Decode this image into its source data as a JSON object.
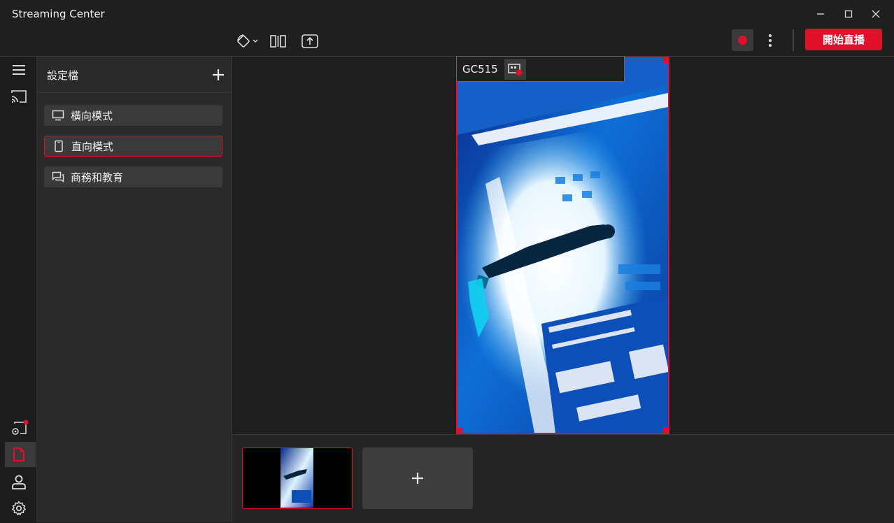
{
  "window": {
    "title": "Streaming Center"
  },
  "toolbar": {
    "go_live_label": "開始直播",
    "record_color": "#e0102a"
  },
  "sidebar": {
    "title": "設定檔",
    "profiles": [
      {
        "label": "橫向模式",
        "icon": "monitor-icon",
        "selected": false
      },
      {
        "label": "直向模式",
        "icon": "phone-icon",
        "selected": true
      },
      {
        "label": "商務和教育",
        "icon": "chat-icon",
        "selected": false
      }
    ]
  },
  "preview": {
    "source_name": "GC515"
  },
  "colors": {
    "accent": "#e0102a",
    "background": "#1e1e1e",
    "panel": "#2a2a2a"
  }
}
